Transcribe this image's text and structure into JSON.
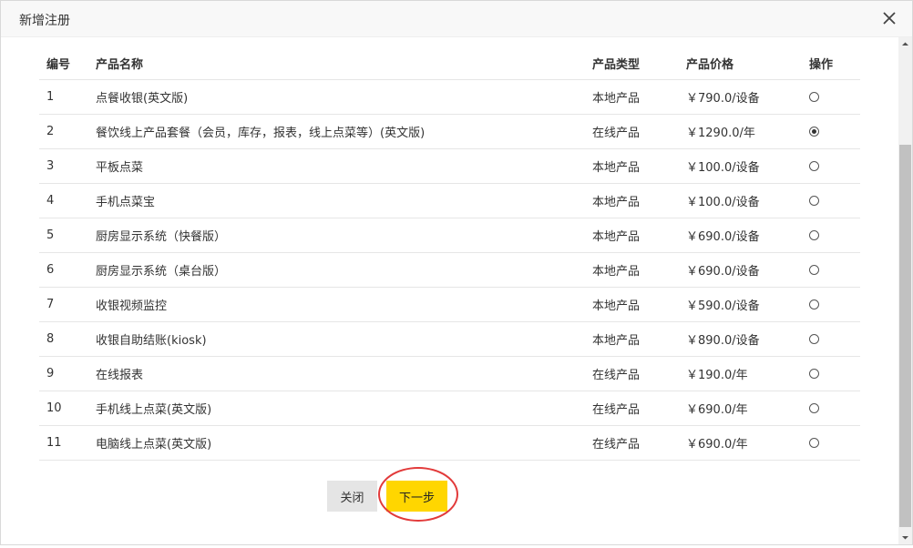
{
  "dialog": {
    "title": "新增注册"
  },
  "table": {
    "headers": [
      "编号",
      "产品名称",
      "产品类型",
      "产品价格",
      "操作"
    ],
    "rows": [
      {
        "no": "1",
        "name": "点餐收银(英文版)",
        "type": "本地产品",
        "price": "￥790.0/设备",
        "selected": false
      },
      {
        "no": "2",
        "name": "餐饮线上产品套餐（会员，库存，报表，线上点菜等）(英文版)",
        "type": "在线产品",
        "price": "￥1290.0/年",
        "selected": true
      },
      {
        "no": "3",
        "name": "平板点菜",
        "type": "本地产品",
        "price": "￥100.0/设备",
        "selected": false
      },
      {
        "no": "4",
        "name": "手机点菜宝",
        "type": "本地产品",
        "price": "￥100.0/设备",
        "selected": false
      },
      {
        "no": "5",
        "name": "厨房显示系统（快餐版）",
        "type": "本地产品",
        "price": "￥690.0/设备",
        "selected": false
      },
      {
        "no": "6",
        "name": "厨房显示系统（桌台版）",
        "type": "本地产品",
        "price": "￥690.0/设备",
        "selected": false
      },
      {
        "no": "7",
        "name": "收银视频监控",
        "type": "本地产品",
        "price": "￥590.0/设备",
        "selected": false
      },
      {
        "no": "8",
        "name": "收银自助结账(kiosk)",
        "type": "本地产品",
        "price": "￥890.0/设备",
        "selected": false
      },
      {
        "no": "9",
        "name": "在线报表",
        "type": "在线产品",
        "price": "￥190.0/年",
        "selected": false
      },
      {
        "no": "10",
        "name": "手机线上点菜(英文版)",
        "type": "在线产品",
        "price": "￥690.0/年",
        "selected": false
      },
      {
        "no": "11",
        "name": "电脑线上点菜(英文版)",
        "type": "在线产品",
        "price": "￥690.0/年",
        "selected": false
      }
    ]
  },
  "buttons": {
    "close_label": "关闭",
    "next_label": "下一步"
  },
  "colors": {
    "next_button": "#ffd600",
    "annotation": "#e23a3a"
  }
}
